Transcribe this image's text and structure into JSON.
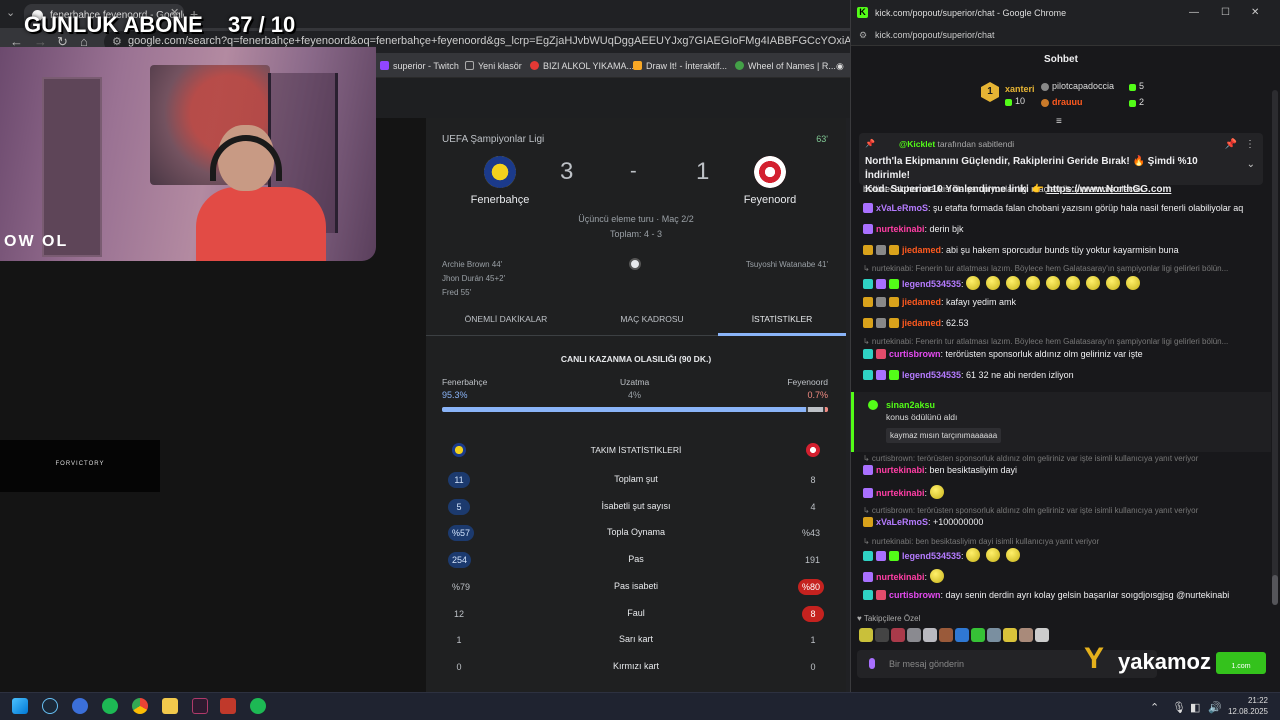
{
  "overlay": {
    "subscriber_label": "GUNLUK ABONE",
    "subscriber_count": "37 / 10",
    "cam_logo": "OW OL",
    "sponsor_box": "FORVICTORY"
  },
  "browser": {
    "tab_title": "fenerbahçe feyenoord - Google",
    "url": "google.com/search?q=fenerbahçe+feyenoord&oq=fenerbahçe+feyenoord&gs_lcrp=EgZjaHJvbWUqDggAEEUYJxg7GIAEGIoFMg4IABBFGCcYOxiABBiKBTINCAEQABiDARixAxiABDIN",
    "bookmarks": [
      {
        "label": "superior - Twitch",
        "color": "#9146ff"
      },
      {
        "label": "Yeni klasör",
        "color": "#9aa0a6"
      },
      {
        "label": "BIZI ALKOL YIKAMA...",
        "color": "#e53935"
      },
      {
        "label": "Draw It! - İnteraktif...",
        "color": "#f9a825"
      },
      {
        "label": "Wheel of Names | R...",
        "color": "#43a047"
      }
    ]
  },
  "match": {
    "league": "UEFA Şampiyonlar Ligi",
    "minute": "63'",
    "home_team": "Fenerbahçe",
    "away_team": "Feyenoord",
    "home_score": "3",
    "separator": "-",
    "away_score": "1",
    "round": "Üçüncü eleme turu · Maç 2/2",
    "aggregate": "Toplam: 4 - 3",
    "home_scorers": [
      "Archie Brown 44'",
      "Jhon Durán 45+2'",
      "Fred 55'"
    ],
    "away_scorers": [
      "Tsuyoshi Watanabe 41'"
    ],
    "tabs": [
      "ÖNEMLİ DAKİKALAR",
      "MAÇ KADROSU",
      "İSTATİSTİKLER"
    ],
    "win_prob": {
      "title": "CANLI KAZANMA OLASILIĞI (90 DK.)",
      "home_label": "Fenerbahçe",
      "draw_label": "Uzatma",
      "away_label": "Feyenoord",
      "home_value": "95.3%",
      "draw_value": "4%",
      "away_value": "0.7%",
      "home_pct": 95.3,
      "draw_pct": 4,
      "away_pct": 0.7
    },
    "stats_title": "TAKIM İSTATİSTİKLERİ",
    "stats": [
      {
        "label": "Toplam şut",
        "home": "11",
        "away": "8",
        "home_style": "pill-blue",
        "away_style": "plain"
      },
      {
        "label": "İsabetli şut sayısı",
        "home": "5",
        "away": "4",
        "home_style": "pill-blue",
        "away_style": "plain"
      },
      {
        "label": "Topla Oynama",
        "home": "%57",
        "away": "%43",
        "home_style": "pill-blue",
        "away_style": "plain"
      },
      {
        "label": "Pas",
        "home": "254",
        "away": "191",
        "home_style": "pill-blue",
        "away_style": "plain"
      },
      {
        "label": "Pas isabeti",
        "home": "%79",
        "away": "%80",
        "home_style": "plain",
        "away_style": "pill-red"
      },
      {
        "label": "Faul",
        "home": "12",
        "away": "8",
        "home_style": "plain",
        "away_style": "pill-red"
      },
      {
        "label": "Sarı kart",
        "home": "1",
        "away": "1",
        "home_style": "plain",
        "away_style": "plain"
      },
      {
        "label": "Kırmızı kart",
        "home": "0",
        "away": "0",
        "home_style": "plain",
        "away_style": "plain"
      }
    ]
  },
  "chat_window": {
    "title": "kick.com/popout/superior/chat - Google Chrome",
    "url": "kick.com/popout/superior/chat",
    "header": "Sohbet",
    "leaderboard": {
      "rank": "1",
      "first_name": "xanteri",
      "first_value": "10",
      "second_name": "pilotcapadoccia",
      "second_value": "5",
      "third_name": "drauuu",
      "third_value": "2"
    },
    "pinned": {
      "by_user": "@Kicklet",
      "by_suffix": "tarafından sabitlendi",
      "line1": "North'la Ekipmanını Güçlendir, Rakiplerini Geride Bırak! 🔥 Şimdi %10 İndirimle!",
      "line2": "Kod: Superior10 Yönlendirme linki 👉",
      "link": "https://www.NorthGG.com"
    },
    "top_cut_text": "bölünecek hemde ikisi de şampiyonlar ligi maçları ile yıpranmış olacak.",
    "messages": [
      {
        "user": "xVaLeRmoS",
        "text": ": şu etafta formada falan chobani yazısını görüp hala nasil fenerli olabiliyolar aq"
      },
      {
        "user": "nurtekinabi",
        "text": ": derin bjk"
      },
      {
        "user": "jiedamed",
        "text": ": abi şu hakem sporcudur bunds tüy yoktur kayarmisin buna"
      },
      {
        "reply": "↳ nurtekinabi: Fenerin tur atlatması lazım. Böylece hem Galatasaray'ın şampiyonlar ligi gelirleri bölün..."
      },
      {
        "user": "legend534535",
        "text": ":"
      },
      {
        "user": "jiedamed",
        "text": ": kafayı yedim amk"
      },
      {
        "user": "jiedamed",
        "text": ": 62.53"
      },
      {
        "reply": "↳ nurtekinabi: Fenerin tur atlatması lazım. Böylece hem Galatasaray'ın şampiyonlar ligi gelirleri bölün..."
      },
      {
        "user": "curtisbrown",
        "text": ": terörüsten sponsorluk aldınız olm geliriniz var işte"
      },
      {
        "user": "legend534535",
        "text": ": 61 32 ne abi nerden izliyon"
      },
      {
        "reply": "↳ curtisbrown: terörüsten sponsorluk aldınız olm geliriniz var işte isimli kullanıcıya yanıt veriyor"
      },
      {
        "user": "nurtekinabi",
        "text": ": ben besiktasliyim dayi"
      },
      {
        "user": "nurtekinabi",
        "text": ":"
      },
      {
        "reply": "↳ curtisbrown: terörüsten sponsorluk aldınız olm geliriniz var işte isimli kullanıcıya yanıt veriyor"
      },
      {
        "user": "xVaLeRmoS",
        "text": ": +100000000"
      },
      {
        "reply": "↳ nurtekinabi: ben besiktasliyim dayi isimli kullanıcıya yanıt veriyor"
      },
      {
        "user": "legend534535",
        "text": ":"
      },
      {
        "user": "nurtekinabi",
        "text": ":"
      },
      {
        "user": "curtisbrown",
        "text": ": dayı senin derdin ayrı kolay gelsin başarılar soıgdjoısgjsg @nurtekinabi"
      }
    ],
    "redeem": {
      "user": "sinan2aksu",
      "action": "konus ödülünü aldı",
      "message": "kaymaz mısın tarçınımaaaaaa"
    },
    "followers_label": "Takipçilere Özel",
    "input_placeholder": "Bir mesaj gönderin"
  },
  "branding": {
    "sponsor_logo": "yakamoz",
    "sponsor_badge": "1.com"
  },
  "taskbar": {
    "time": "21:22",
    "date": "12.08.2025"
  }
}
